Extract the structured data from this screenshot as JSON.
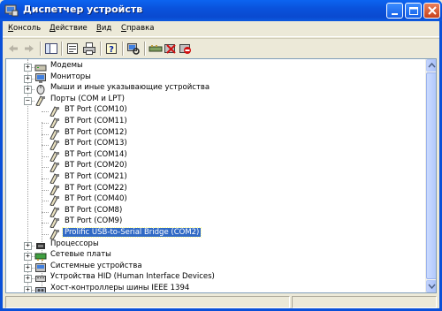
{
  "window": {
    "title": "Диспетчер устройств",
    "colors": {
      "titlebar": "#0a52dc",
      "selection": "#316ac5",
      "face": "#ece9d8"
    }
  },
  "menu": {
    "items": [
      {
        "prefix": "",
        "underline": "К",
        "rest": "онсоль"
      },
      {
        "prefix": "",
        "underline": "Д",
        "rest": "ействие"
      },
      {
        "prefix": "",
        "underline": "В",
        "rest": "ид"
      },
      {
        "prefix": "",
        "underline": "С",
        "rest": "правка"
      }
    ]
  },
  "toolbar": {
    "icons": [
      "back-arrow-icon",
      "forward-arrow-icon",
      "show-hide-tree-icon",
      "properties-icon",
      "print-icon",
      "help-icon",
      "scan-hardware-icon",
      "update-driver-icon",
      "uninstall-icon",
      "disable-icon"
    ]
  },
  "tree": {
    "rows": [
      {
        "label": "Модемы",
        "icon": "modem-icon",
        "expander": "+",
        "level": 1
      },
      {
        "label": "Мониторы",
        "icon": "monitor-icon",
        "expander": "+",
        "level": 1
      },
      {
        "label": "Мыши и иные указывающие устройства",
        "icon": "mouse-icon",
        "expander": "+",
        "level": 1
      },
      {
        "label": "Порты (COM и LPT)",
        "icon": "port-icon",
        "expander": "−",
        "level": 1
      },
      {
        "label": "BT Port (COM10)",
        "icon": "com-port-icon",
        "level": 2
      },
      {
        "label": "BT Port (COM11)",
        "icon": "com-port-icon",
        "level": 2
      },
      {
        "label": "BT Port (COM12)",
        "icon": "com-port-icon",
        "level": 2
      },
      {
        "label": "BT Port (COM13)",
        "icon": "com-port-icon",
        "level": 2
      },
      {
        "label": "BT Port (COM14)",
        "icon": "com-port-icon",
        "level": 2
      },
      {
        "label": "BT Port (COM20)",
        "icon": "com-port-icon",
        "level": 2
      },
      {
        "label": "BT Port (COM21)",
        "icon": "com-port-icon",
        "level": 2
      },
      {
        "label": "BT Port (COM22)",
        "icon": "com-port-icon",
        "level": 2
      },
      {
        "label": "BT Port (COM40)",
        "icon": "com-port-icon",
        "level": 2
      },
      {
        "label": "BT Port (COM8)",
        "icon": "com-port-icon",
        "level": 2
      },
      {
        "label": "BT Port (COM9)",
        "icon": "com-port-icon",
        "level": 2
      },
      {
        "label": "Prolific USB-to-Serial Bridge (COM2)",
        "icon": "com-port-icon",
        "level": 2,
        "selected": true
      },
      {
        "label": "Процессоры",
        "icon": "processor-icon",
        "expander": "+",
        "level": 1
      },
      {
        "label": "Сетевые платы",
        "icon": "network-card-icon",
        "expander": "+",
        "level": 1
      },
      {
        "label": "Системные устройства",
        "icon": "system-device-icon",
        "expander": "+",
        "level": 1
      },
      {
        "label": "Устройства HID (Human Interface Devices)",
        "icon": "hid-icon",
        "expander": "+",
        "level": 1
      },
      {
        "label": "Хост-контроллеры шины IEEE 1394",
        "icon": "ieee1394-icon",
        "expander": "+",
        "level": 1
      }
    ]
  }
}
